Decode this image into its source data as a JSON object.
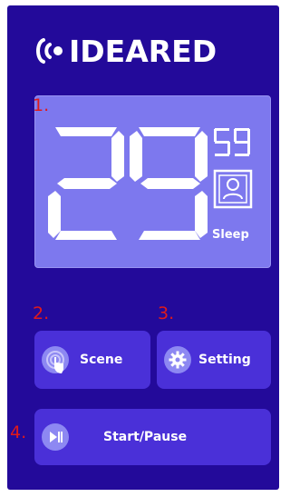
{
  "brand": {
    "name": "IDEARED"
  },
  "display": {
    "minutes": "29",
    "seconds": "59",
    "mode_icon": "sleep-mask-icon",
    "mode_label": "Sleep"
  },
  "annotations": [
    "1.",
    "2.",
    "3.",
    "4."
  ],
  "buttons": {
    "scene": {
      "label": "Scene",
      "icon": "touch-hand-icon"
    },
    "setting": {
      "label": "Setting",
      "icon": "gear-icon"
    },
    "start": {
      "label": "Start/Pause",
      "icon": "play-pause-icon"
    }
  },
  "colors": {
    "background": "#230a9a",
    "panel": "#7d78ee",
    "button": "#4a30d8",
    "annotation": "#e01a1a"
  }
}
